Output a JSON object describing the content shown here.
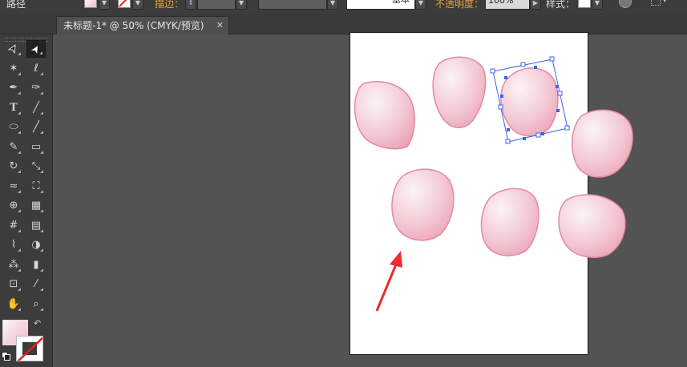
{
  "control_bar": {
    "title_label": "路径",
    "stroke_label": "描边：",
    "stroke_style": "基本",
    "opacity_label": "不透明度：",
    "opacity_value": "100%",
    "style_label": "样式："
  },
  "document_tab": {
    "title": "未标题-1* @ 50% (CMYK/预览)",
    "close_glyph": "✕"
  },
  "tools": [
    {
      "name": "selection-tool",
      "icon": "arrow"
    },
    {
      "name": "direct-selection-tool",
      "icon": "white-arrow",
      "selected": true
    },
    {
      "name": "magic-wand-tool",
      "icon": "magic-wand"
    },
    {
      "name": "lasso-tool",
      "icon": "lasso"
    },
    {
      "name": "pen-tool",
      "icon": "pen"
    },
    {
      "name": "curvature-tool",
      "icon": "pen-curve"
    },
    {
      "name": "type-tool",
      "icon": "T"
    },
    {
      "name": "line-tool",
      "icon": "line"
    },
    {
      "name": "ellipse-tool",
      "icon": "ellipse"
    },
    {
      "name": "paintbrush-tool",
      "icon": "brush"
    },
    {
      "name": "pencil-tool",
      "icon": "pencil"
    },
    {
      "name": "eraser-tool",
      "icon": "eraser"
    },
    {
      "name": "rotate-tool",
      "icon": "rotate"
    },
    {
      "name": "scale-tool",
      "icon": "scale"
    },
    {
      "name": "warp-tool",
      "icon": "warp"
    },
    {
      "name": "free-transform-tool",
      "icon": "free-transform"
    },
    {
      "name": "shape-builder-tool",
      "icon": "shape-builder"
    },
    {
      "name": "perspective-grid-tool",
      "icon": "perspective"
    },
    {
      "name": "mesh-tool",
      "icon": "mesh"
    },
    {
      "name": "gradient-tool",
      "icon": "gradient"
    },
    {
      "name": "eyedropper-tool",
      "icon": "eyedropper"
    },
    {
      "name": "blend-tool",
      "icon": "blend"
    },
    {
      "name": "symbol-sprayer-tool",
      "icon": "sprayer"
    },
    {
      "name": "column-graph-tool",
      "icon": "graph"
    },
    {
      "name": "artboard-tool",
      "icon": "artboard"
    },
    {
      "name": "slice-tool",
      "icon": "knife"
    },
    {
      "name": "hand-tool",
      "icon": "hand"
    },
    {
      "name": "zoom-tool",
      "icon": "zoom"
    }
  ],
  "colors": {
    "petal_light": "#fbf3f5",
    "petal_mid": "#f1bccb",
    "petal_edge": "#e58aa0",
    "selection_blue": "#3a63f0",
    "arrow_red": "#ef2b2b",
    "artboard": "#ffffff",
    "pasteboard": "#535353"
  }
}
